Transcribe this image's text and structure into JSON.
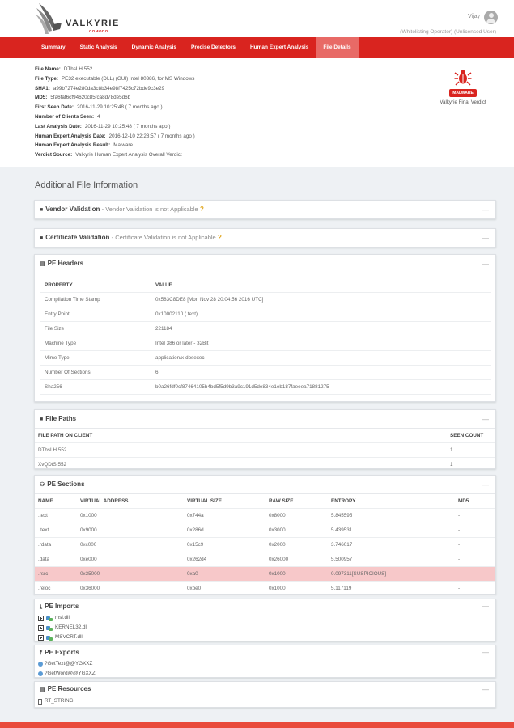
{
  "header": {
    "logo_text": "VALKYRIE",
    "logo_sub": "COMODO",
    "user_name": "Vijay",
    "user_role": "(Whitelisting Operator) (Unlicensed User)"
  },
  "nav": {
    "tabs": [
      "Summary",
      "Static Analysis",
      "Dynamic Analysis",
      "Precise Detectors",
      "Human Expert Analysis",
      "File Details"
    ],
    "active": "File Details"
  },
  "summary": [
    {
      "label": "File Name:",
      "value": "DThsLH.552"
    },
    {
      "label": "File Type:",
      "value": "PE32 executable (DLL) (GUI) Intel 80386, for MS Windows"
    },
    {
      "label": "SHA1:",
      "value": "a99b7274e280da3c8b34e98f7425c72bde9c3e29"
    },
    {
      "label": "MD5:",
      "value": "5fa6faf6cf94620c85fca8d78de5d6b"
    },
    {
      "label": "First Seen Date:",
      "value": "2016-11-29 10:25:48 ( 7 months ago )"
    },
    {
      "label": "Number of Clients Seen:",
      "value": "4"
    },
    {
      "label": "Last Analysis Date:",
      "value": "2016-11-29 10:25:48 ( 7 months ago )"
    },
    {
      "label": "Human Expert Analysis Date:",
      "value": "2016-12-10 22:28:57 ( 7 months ago )"
    },
    {
      "label": "Human Expert Analysis Result:",
      "value": "Malware"
    },
    {
      "label": "Verdict Source:",
      "value": "Valkyrie Human Expert Analysis Overall Verdict"
    }
  ],
  "verdict": {
    "badge": "MALWARE",
    "label": "Valkyrie Final Verdict",
    "badge_color": "#d9241f"
  },
  "section_title": "Additional File Information",
  "vendor_validation": {
    "title": "Vendor Validation",
    "note": "Vendor Validation is not Applicable",
    "q": "?",
    "collapse": "—"
  },
  "certificate_validation": {
    "title": "Certificate Validation",
    "note": "Certificate Validation is not Applicable",
    "q": "?",
    "collapse": "—"
  },
  "pe_headers": {
    "title": "PE Headers",
    "collapse": "—",
    "col_property": "PROPERTY",
    "col_value": "VALUE",
    "rows": [
      {
        "k": "Compilation Time Stamp",
        "v": "0x583C8DE8 [Mon Nov 28 20:04:56 2016 UTC]"
      },
      {
        "k": "Entry Point",
        "v": "0x10002110 (.text)"
      },
      {
        "k": "File Size",
        "v": "221184"
      },
      {
        "k": "Machine Type",
        "v": "Intel 386 or later - 32Bit"
      },
      {
        "k": "Mime Type",
        "v": "application/x-dosexec"
      },
      {
        "k": "Number Of Sections",
        "v": "6"
      },
      {
        "k": "Sha256",
        "v": "b0a26fdf0cf87464105b4bd5f5d9b3a9c191d5de834e1eb187faeeea71881275"
      }
    ]
  },
  "file_paths": {
    "title": "File Paths",
    "collapse": "—",
    "col_path": "FILE PATH ON CLIENT",
    "col_count": "SEEN COUNT",
    "rows": [
      {
        "path": "DThsLH.552",
        "count": "1"
      },
      {
        "path": "XvQDtS.552",
        "count": "1"
      }
    ]
  },
  "pe_sections": {
    "title": "PE Sections",
    "collapse": "—",
    "columns": [
      "NAME",
      "VIRTUAL ADDRESS",
      "VIRTUAL SIZE",
      "RAW SIZE",
      "ENTROPY",
      "MD5"
    ],
    "rows": [
      [
        ".text",
        "0x1000",
        "0x744a",
        "0x8000",
        "5.845595",
        "-"
      ],
      [
        ".itext",
        "0x9000",
        "0x286d",
        "0x3000",
        "5.439531",
        "-"
      ],
      [
        ".rdata",
        "0xc000",
        "0x15c9",
        "0x2000",
        "3.746017",
        "-"
      ],
      [
        ".data",
        "0xe000",
        "0x262d4",
        "0x26000",
        "5.500957",
        "-"
      ],
      [
        ".rsrc",
        "0x35000",
        "0xa0",
        "0x1000",
        "0.097311[SUSPICIOUS]",
        "-"
      ],
      [
        ".reloc",
        "0x36000",
        "0xbe0",
        "0x1000",
        "5.117119",
        "-"
      ]
    ],
    "suspicious_row": 4
  },
  "pe_imports": {
    "title": "PE Imports",
    "collapse": "—",
    "items": [
      "msi.dll",
      "KERNEL32.dll",
      "MSVCRT.dll"
    ]
  },
  "pe_exports": {
    "title": "PE Exports",
    "collapse": "—",
    "items": [
      "?GetText@@YGXXZ",
      "?GetWord@@YGXXZ"
    ]
  },
  "pe_resources": {
    "title": "PE Resources",
    "collapse": "—",
    "items": [
      "RT_STRING"
    ]
  }
}
